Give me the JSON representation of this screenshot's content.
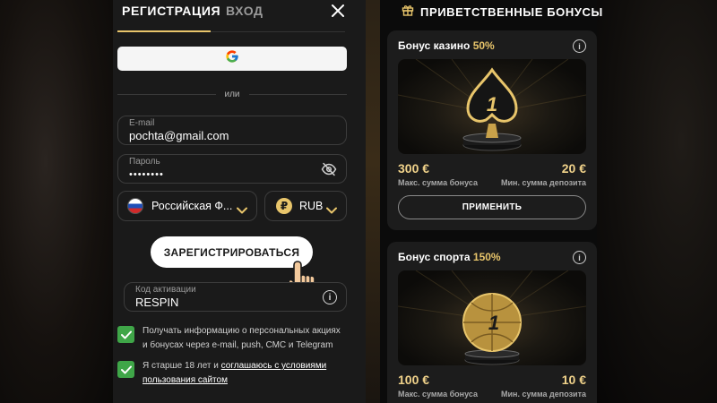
{
  "registration": {
    "tabs": [
      {
        "label": "РЕГИСТРАЦИЯ",
        "active": true
      },
      {
        "label": "ВХОД",
        "active": false
      }
    ],
    "close_icon": "close-icon",
    "google_icon": "google-icon",
    "or_text": "или",
    "email": {
      "label": "E-mail",
      "value": "pochta@gmail.com"
    },
    "password": {
      "label": "Пароль",
      "value": "••••••••",
      "icon": "eye-off-icon"
    },
    "country": {
      "value": "Российская Ф...",
      "icon": "russia-flag-icon"
    },
    "currency": {
      "value": "RUB",
      "symbol": "₽"
    },
    "register_button": "ЗАРЕГИСТРИРОВАТЬСЯ",
    "promo": {
      "label": "Код активации",
      "value": "RESPIN",
      "icon_text": "i"
    },
    "consents": [
      {
        "checked": true,
        "text": "Получать информацию о персональных акциях и бонусах через e-mail, push, СМС и Telegram"
      },
      {
        "checked": true,
        "text_prefix": "Я старше 18 лет и ",
        "link_text": "соглашаюсь с условиями пользования сайтом"
      }
    ]
  },
  "bonuses": {
    "header": "ПРИВЕТСТВЕННЫЕ БОНУСЫ",
    "header_icon": "gift-icon",
    "cards": [
      {
        "title": "Бонус казино",
        "percent": "50%",
        "info_text": "i",
        "image": "spade-trophy-1",
        "image_number": "1",
        "max_amount": "300 €",
        "max_label": "Макс. сумма бонуса",
        "min_deposit": "20 €",
        "min_label": "Мин. сумма депозита",
        "button": "ПРИМЕНИТЬ"
      },
      {
        "title": "Бонус спорта",
        "percent": "150%",
        "info_text": "i",
        "image": "golden-ball-1",
        "image_number": "1",
        "max_amount": "100 €",
        "max_label": "Макс. сумма бонуса",
        "min_deposit": "10 €",
        "min_label": "Мин. сумма депозита"
      }
    ]
  },
  "colors": {
    "accent_gold": "#e8c56b",
    "panel": "#1a1a1a",
    "check_green": "#3fa648",
    "background": "#0b0b0b"
  }
}
